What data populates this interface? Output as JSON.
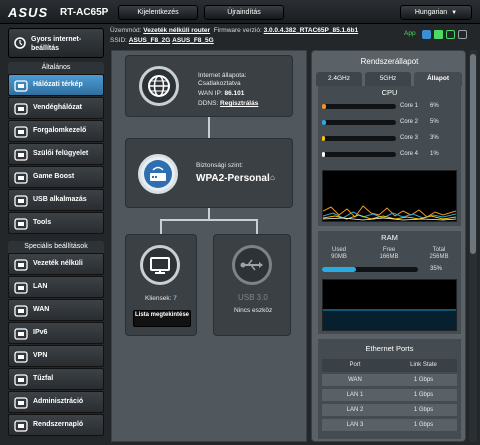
{
  "header": {
    "logo": "ASUS",
    "model": "RT-AC65P",
    "logout_label": "Kijelentkezés",
    "reboot_label": "Újraindítás",
    "language": "Hungarian"
  },
  "info": {
    "mode_label": "Üzemmód:",
    "mode_value": "Vezeték nélküli router",
    "firmware_label": "Firmware verzió:",
    "firmware_value": "3.0.0.4.382_RTAC65P_85.1.6b1",
    "ssid_label": "SSID:",
    "ssid_24": "ASUS_F8_2G",
    "ssid_5": "ASUS_F8_5G",
    "app_label": "App"
  },
  "sidebar": {
    "quick_label": "Gyors internet-beállítás",
    "general_header": "Általános",
    "general_items": [
      {
        "label": "Hálózati térkép",
        "icon": "network-map-icon"
      },
      {
        "label": "Vendéghálózat",
        "icon": "guest-network-icon"
      },
      {
        "label": "Forgalomkezelő",
        "icon": "traffic-manager-icon"
      },
      {
        "label": "Szülői felügyelet",
        "icon": "parental-control-icon"
      },
      {
        "label": "Game Boost",
        "icon": "game-boost-icon"
      },
      {
        "label": "USB alkalmazás",
        "icon": "usb-app-icon"
      },
      {
        "label": "Tools",
        "icon": "tools-icon"
      }
    ],
    "advanced_header": "Speciális beállítások",
    "advanced_items": [
      {
        "label": "Vezeték nélküli",
        "icon": "wireless-icon"
      },
      {
        "label": "LAN",
        "icon": "lan-icon"
      },
      {
        "label": "WAN",
        "icon": "wan-icon"
      },
      {
        "label": "IPv6",
        "icon": "ipv6-icon"
      },
      {
        "label": "VPN",
        "icon": "vpn-icon"
      },
      {
        "label": "Tűzfal",
        "icon": "firewall-icon"
      },
      {
        "label": "Adminisztráció",
        "icon": "administration-icon"
      },
      {
        "label": "Rendszernapló",
        "icon": "system-log-icon"
      }
    ]
  },
  "map": {
    "internet_status_label": "Internet állapota:",
    "internet_status": "Csatlakoztatva",
    "wan_ip_label": "WAN IP:",
    "wan_ip": "86.101",
    "ddns_label": "DDNS:",
    "ddns_link": "Regisztrálás",
    "security_label": "Biztonsági szint:",
    "security_value": "WPA2-Personal",
    "clients_label": "Kliensek:",
    "clients_count": "7",
    "clients_button": "Lista megtekintése",
    "usb_label": "USB 3.0",
    "usb_status": "Nincs eszköz"
  },
  "status_panel": {
    "title": "Rendszerállapot",
    "tabs": [
      "2.4GHz",
      "5GHz",
      "Állapot"
    ],
    "active_tab": 2,
    "cpu_title": "CPU",
    "cores": [
      {
        "label": "Core 1",
        "pct": 6,
        "pct_label": "6%",
        "color": "#f7941d"
      },
      {
        "label": "Core 2",
        "pct": 5,
        "pct_label": "5%",
        "color": "#29abe2"
      },
      {
        "label": "Core 3",
        "pct": 3,
        "pct_label": "3%",
        "color": "#f7c600"
      },
      {
        "label": "Core 4",
        "pct": 1,
        "pct_label": "1%",
        "color": "#ffffff"
      }
    ],
    "ram_title": "RAM",
    "ram_used_label": "Used",
    "ram_used": "90MB",
    "ram_free_label": "Free",
    "ram_free": "166MB",
    "ram_total_label": "Total",
    "ram_total": "256MB",
    "ram_pct": 35,
    "ram_pct_label": "35%",
    "eth_title": "Ethernet Ports",
    "eth_headers": [
      "Port",
      "Link State"
    ],
    "eth_rows": [
      {
        "port": "WAN",
        "state": "1 Gbps"
      },
      {
        "port": "LAN 1",
        "state": "1 Gbps"
      },
      {
        "port": "LAN 2",
        "state": "1 Gbps"
      },
      {
        "port": "LAN 3",
        "state": "1 Gbps"
      }
    ]
  },
  "colors": {
    "accent": "#4d9bd3",
    "graph_line": "#2a8fd8"
  }
}
